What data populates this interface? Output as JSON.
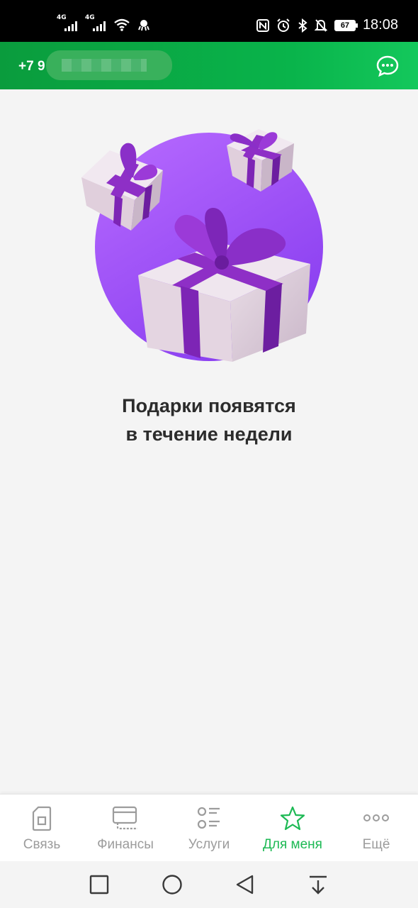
{
  "status_bar": {
    "signal1_tag": "4G",
    "signal2_tag": "4G",
    "battery": "67",
    "time": "18:08"
  },
  "header": {
    "phone_prefix": "+7 9"
  },
  "empty_state": {
    "line1": "Подарки появятся",
    "line2": "в течение недели"
  },
  "tabs": [
    {
      "label": "Связь",
      "icon": "sim-card-icon"
    },
    {
      "label": "Финансы",
      "icon": "card-icon"
    },
    {
      "label": "Услуги",
      "icon": "services-list-icon"
    },
    {
      "label": "Для меня",
      "icon": "star-icon",
      "active": true
    },
    {
      "label": "Ещё",
      "icon": "more-dots-icon"
    }
  ],
  "colors": {
    "accent": "#1db954",
    "header_green": "#0a9c3d",
    "gift_purple": "#a85cf4"
  }
}
